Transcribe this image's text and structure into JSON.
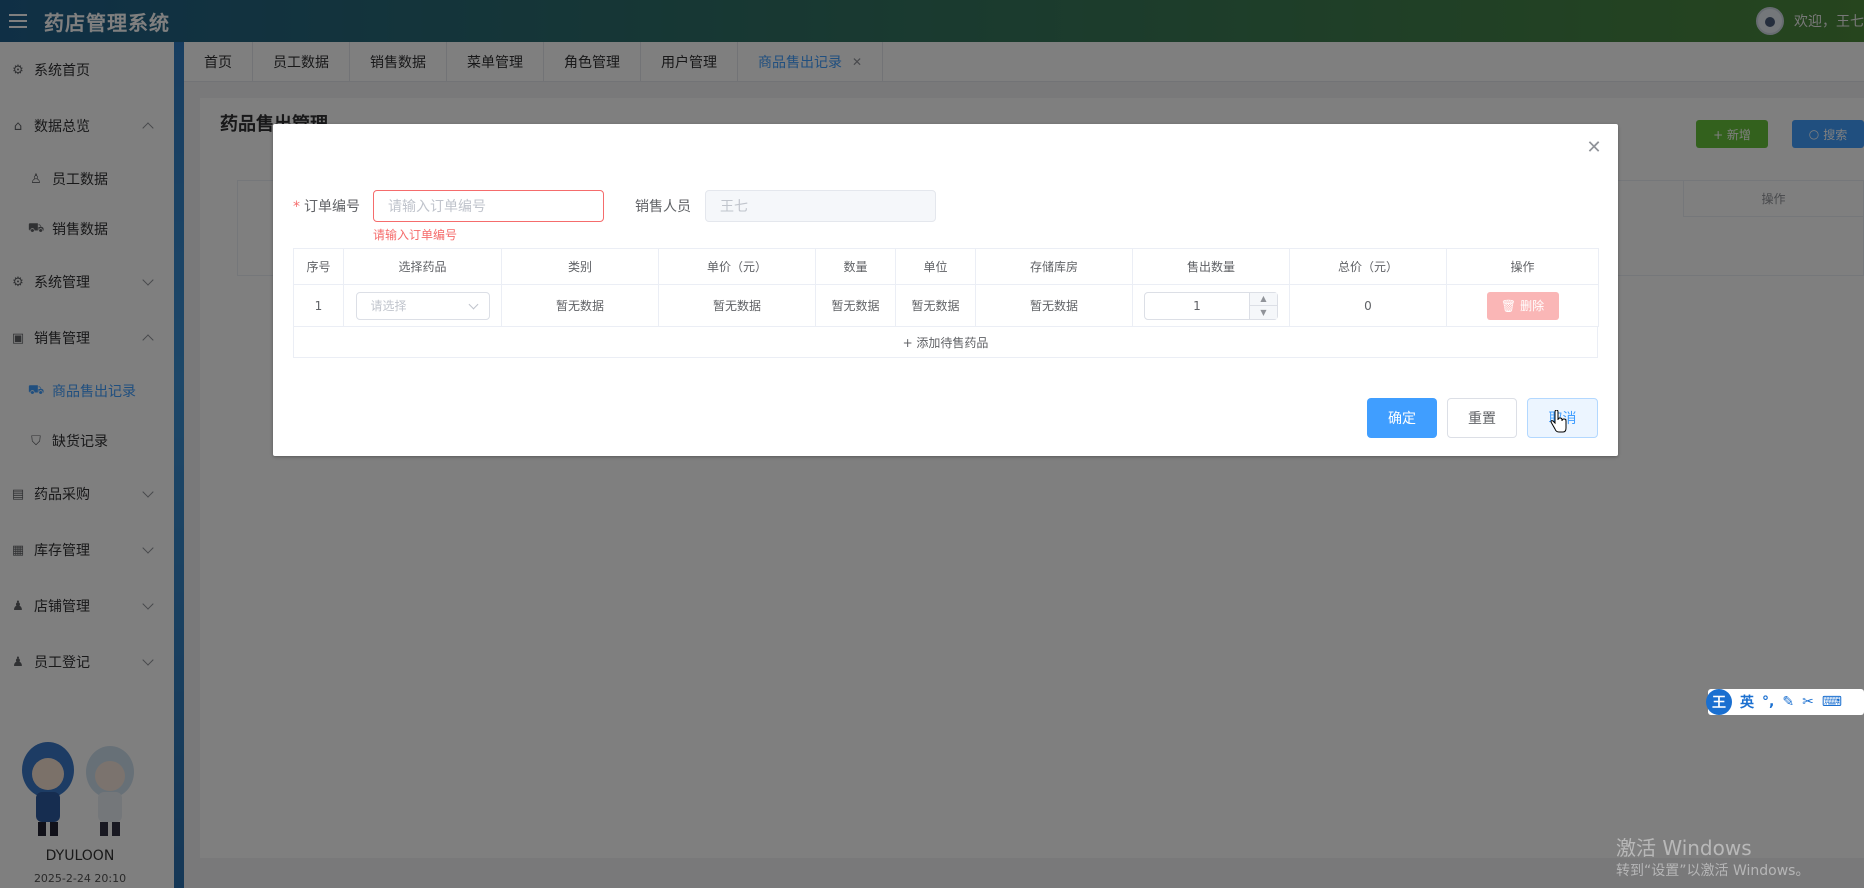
{
  "header": {
    "title": "药店管理系统",
    "welcome": "欢迎，王七"
  },
  "sidebar": {
    "items": [
      {
        "label": "系统首页",
        "icon": "home-gear-icon"
      },
      {
        "label": "数据总览",
        "icon": "house-icon"
      },
      {
        "label": "员工数据",
        "icon": "user-icon"
      },
      {
        "label": "销售数据",
        "icon": "truck-icon"
      },
      {
        "label": "系统管理",
        "icon": "gear-icon"
      },
      {
        "label": "销售管理",
        "icon": "chart-icon"
      },
      {
        "label": "商品售出记录",
        "icon": "truck-icon"
      },
      {
        "label": "缺货记录",
        "icon": "bag-icon"
      },
      {
        "label": "药品采购",
        "icon": "lock-icon"
      },
      {
        "label": "库存管理",
        "icon": "briefcase-icon"
      },
      {
        "label": "店铺管理",
        "icon": "user-icon"
      },
      {
        "label": "员工登记",
        "icon": "user-icon"
      }
    ],
    "brand": "DYULOON",
    "brand_sub": "2025-2-24 20:10"
  },
  "tabs": [
    {
      "label": "首页"
    },
    {
      "label": "员工数据"
    },
    {
      "label": "销售数据"
    },
    {
      "label": "菜单管理"
    },
    {
      "label": "角色管理"
    },
    {
      "label": "用户管理"
    },
    {
      "label": "商品售出记录",
      "active": true
    }
  ],
  "page": {
    "title": "药品售出管理",
    "new_label": "+ 新增",
    "search_label": "搜索",
    "table_op_header": "操作"
  },
  "dialog": {
    "order_label": "订单编号",
    "order_placeholder": "请输入订单编号",
    "order_error": "请输入订单编号",
    "seller_label": "销售人员",
    "seller_value": "王七",
    "columns": [
      "序号",
      "选择药品",
      "类别",
      "单价（元）",
      "数量",
      "单位",
      "存储库房",
      "售出数量",
      "总价（元）",
      "操作"
    ],
    "row": {
      "index": "1",
      "select_placeholder": "请选择",
      "category": "暂无数据",
      "unit_price": "暂无数据",
      "quantity": "暂无数据",
      "unit": "暂无数据",
      "warehouse": "暂无数据",
      "sold_qty": "1",
      "total": "0",
      "delete_label": "删除"
    },
    "add_label": "+ 添加待售药品",
    "confirm_label": "确定",
    "reset_label": "重置",
    "cancel_label": "取消"
  },
  "ime": {
    "badge": "王",
    "lang": "英"
  },
  "watermark": {
    "title": "激活 Windows",
    "subtitle": "转到“设置”以激活 Windows。"
  },
  "colors": {
    "primary": "#409eff",
    "success": "#67c23a",
    "danger": "#f56c6c"
  }
}
